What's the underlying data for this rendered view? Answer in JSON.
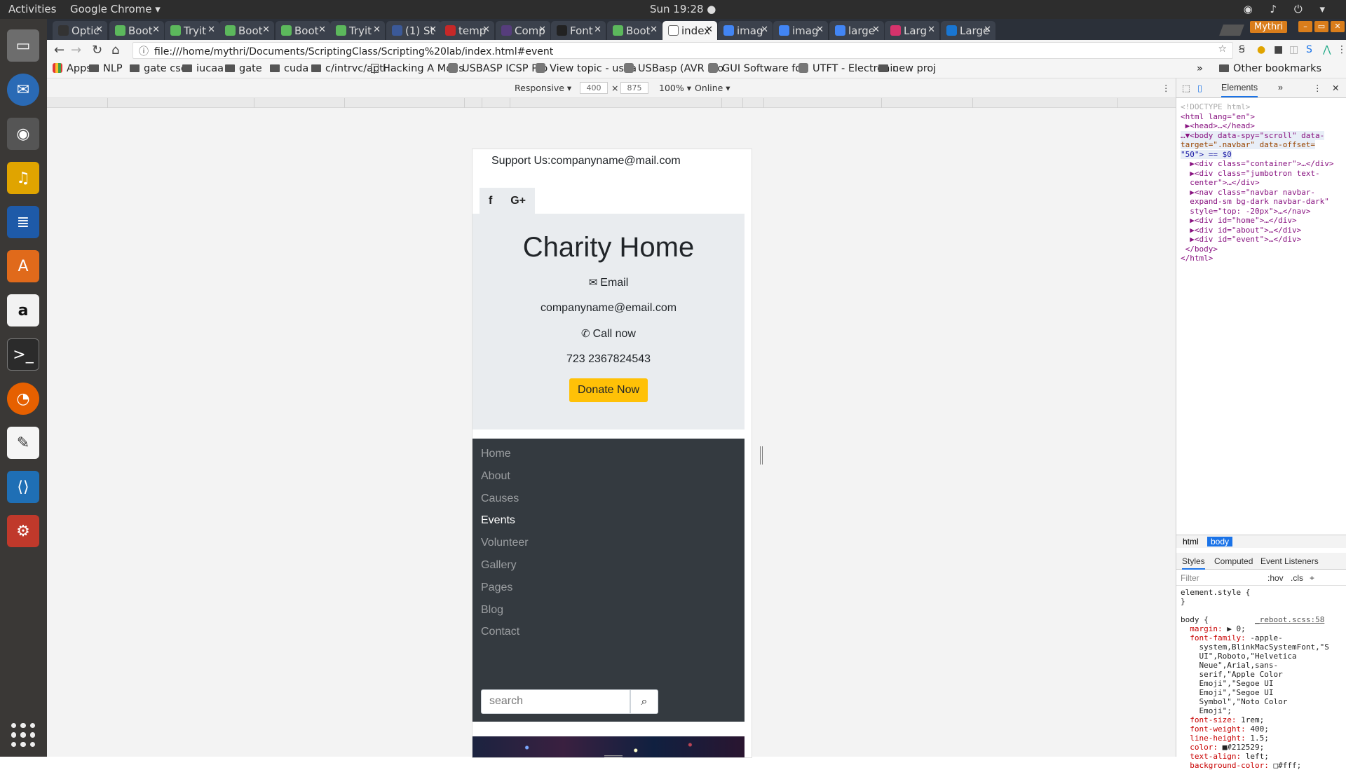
{
  "os": {
    "activities": "Activities",
    "app_name": "Google Chrome ▾",
    "clock": "Sun 19:28 ●",
    "tray": "◉ ♪ ⏻ ▾"
  },
  "dock": {
    "items": [
      "files-icon",
      "thunderbird-icon",
      "chrome-icon",
      "rhythmbox-icon",
      "writer-icon",
      "software-center-icon",
      "amazon-icon",
      "terminal-icon",
      "firefox-icon",
      "text-editor-icon",
      "vscode-icon",
      "settings-icon"
    ]
  },
  "browser": {
    "tabs": [
      "Optic",
      "Boot",
      "Tryit",
      "Boot",
      "Boot",
      "Tryit",
      "(1) St",
      "temp",
      "Comp",
      "Font",
      "Boot",
      "index",
      "imag",
      "imag",
      "large",
      "Larg",
      "Large"
    ],
    "tab_favicons": [
      "#333",
      "#5cb85c",
      "#5cb85c",
      "#5cb85c",
      "#5cb85c",
      "#5cb85c",
      "#3b5998",
      "#c62828",
      "#563d7c",
      "#222",
      "#5cb85c",
      "#fff",
      "#4285f4",
      "#4285f4",
      "#4285f4",
      "#d6336c",
      "#1976d2"
    ],
    "active_tab": 11,
    "profile": "Mythri",
    "url": "file:///home/mythri/Documents/ScriptingClass/Scripting%20lab/index.html#event",
    "bookmarks": [
      {
        "label": "Apps",
        "type": "apps"
      },
      {
        "label": "NLP",
        "type": "folder"
      },
      {
        "label": "gate cse",
        "type": "folder"
      },
      {
        "label": "iucaa",
        "type": "folder"
      },
      {
        "label": "gate",
        "type": "folder"
      },
      {
        "label": "cuda",
        "type": "folder"
      },
      {
        "label": "c/intrvc/apti",
        "type": "folder"
      },
      {
        "label": "Hacking A Mous",
        "type": "page"
      },
      {
        "label": "USBASP ICSP Pro",
        "type": "site"
      },
      {
        "label": "View topic - usba",
        "type": "site"
      },
      {
        "label": "USBasp (AVR Pro",
        "type": "site"
      },
      {
        "label": "GUI Software for",
        "type": "site"
      },
      {
        "label": "UTFT - Electronic",
        "type": "site"
      },
      {
        "label": "new proj",
        "type": "folder"
      }
    ],
    "bookmarks_overflow": "»",
    "other_bookmarks": "Other bookmarks"
  },
  "device_toolbar": {
    "mode": "Responsive ▾",
    "width": "400",
    "times": "×",
    "height": "875",
    "zoom": "100% ▾",
    "network": "Online ▾"
  },
  "site": {
    "support": "Support Us:companyname@mail.com",
    "social": [
      "f",
      "G+"
    ],
    "title": "Charity Home",
    "email_label": "Email",
    "email": "companyname@email.com",
    "call_label": "Call now",
    "phone": "723 2367824543",
    "donate": "Donate Now",
    "nav": [
      "Home",
      "About",
      "Causes",
      "Events",
      "Volunteer",
      "Gallery",
      "Pages",
      "Blog",
      "Contact"
    ],
    "active_nav": "Events",
    "search_placeholder": "search"
  },
  "devtools": {
    "tab_elements": "Elements",
    "more": "»",
    "dom": {
      "doctype": "<!DOCTYPE html>",
      "html_open": "<html lang=\"en\">",
      "head": "▶<head>…</head>",
      "body_open": "…▼<body data-spy=\"scroll\" data-",
      "body_l2": "target=\".navbar\" data-offset=",
      "body_l3": "\"50\"> == $0",
      "div_container": "▶<div class=\"container\">…</div>",
      "div_jumbo": "▶<div class=\"jumbotron text-",
      "div_jumbo2": "center\">…</div>",
      "nav1": "▶<nav class=\"navbar navbar-",
      "nav2": "expand-sm bg-dark navbar-dark\"",
      "nav3": "style=\"top: -20px\">…</nav>",
      "home": "▶<div id=\"home\">…</div>",
      "about": "▶<div id=\"about\">…</div>",
      "event": "▶<div id=\"event\">…</div>",
      "body_close": "</body>",
      "html_close": "</html>"
    },
    "crumbs": [
      "html",
      "body"
    ],
    "style_tabs": [
      "Styles",
      "Computed",
      "Event Listeners"
    ],
    "filter": "Filter",
    "hov": ":hov",
    "cls": ".cls",
    "plus": "+",
    "css": {
      "element_style": "element.style {",
      "close": "}",
      "body_sel": "body {",
      "source": "_reboot.scss:58",
      "margin": "margin:",
      "margin_val": " ▶ 0;",
      "ff": "font-family:",
      "ff_val1": " -apple-",
      "ff_val2": "system,BlinkMacSystemFont,\"S",
      "ff_val3": "UI\",Roboto,\"Helvetica",
      "ff_val4": "Neue\",Arial,sans-",
      "ff_val5": "serif,\"Apple Color",
      "ff_val6": "Emoji\",\"Segoe UI",
      "ff_val7": "Emoji\",\"Segoe UI",
      "ff_val8": "Symbol\",\"Noto Color",
      "ff_val9": "Emoji\";",
      "fs": "font-size:",
      "fs_val": " 1rem;",
      "fw": "font-weight:",
      "fw_val": " 400;",
      "lh": "line-height:",
      "lh_val": " 1.5;",
      "color": "color:",
      "color_val": " ■#212529;",
      "ta": "text-align:",
      "ta_val": " left;",
      "bg": "background-color:",
      "bg_val": " □#fff;"
    }
  }
}
